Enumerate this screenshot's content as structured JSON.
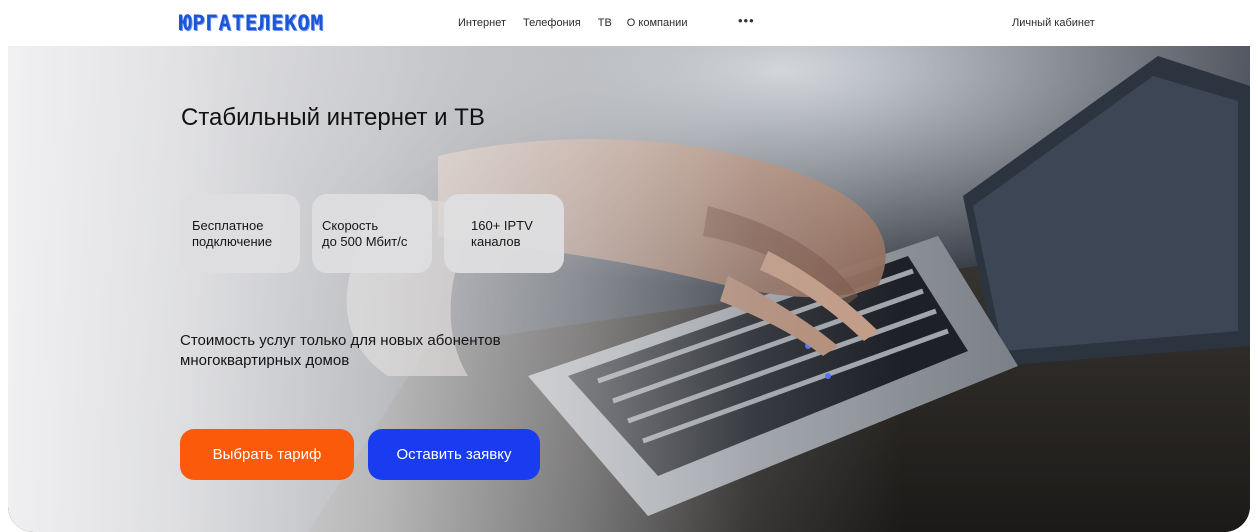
{
  "header": {
    "logo": "ЮРГАТЕЛЕКОМ",
    "nav": [
      "Интернет",
      "Телефония",
      "ТВ",
      "О компании"
    ],
    "more": "•••",
    "account": "Личный кабинет"
  },
  "hero": {
    "title": "Стабильный интернет и ТВ",
    "features": [
      "Бесплатное\nподключение",
      "Скорость\nдо 500 Мбит/с",
      "160+ IPTV\nканалов"
    ],
    "notice": "Стоимость услуг только для новых абонентов\nмногоквартирных домов",
    "buttons": {
      "tariff": "Выбрать тариф",
      "request": "Оставить заявку"
    }
  },
  "colors": {
    "logo": "#1c56d8",
    "accent_orange": "#fb5a0a",
    "accent_blue": "#1a3cf0",
    "feature_bg": "#dedee0"
  }
}
